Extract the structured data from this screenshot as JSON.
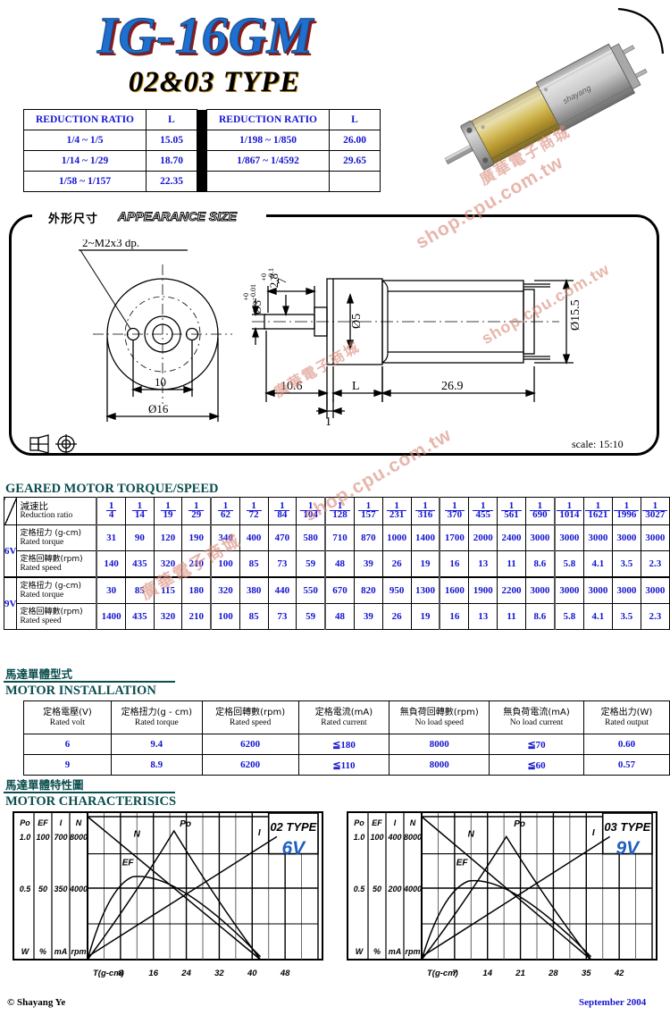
{
  "header": {
    "product_title": "IG-16GM",
    "product_subtitle": "02&03 TYPE"
  },
  "reduction_table": {
    "headers": [
      "REDUCTION RATIO",
      "L"
    ],
    "left_rows": [
      {
        "ratio": "1/4 ~ 1/5",
        "l": "15.05"
      },
      {
        "ratio": "1/14 ~ 1/29",
        "l": "18.70"
      },
      {
        "ratio": "1/58 ~ 1/157",
        "l": "22.35"
      }
    ],
    "right_rows": [
      {
        "ratio": "1/198 ~ 1/850",
        "l": "26.00"
      },
      {
        "ratio": "1/867 ~ 1/4592",
        "l": "29.65"
      },
      {
        "ratio": "",
        "l": ""
      }
    ]
  },
  "appearance": {
    "title_cn": "外形尺寸",
    "title_en": "APPEARANCE SIZE",
    "scale_label": "scale:  15:10",
    "dims": {
      "thread_note": "2~M2x3  dp.",
      "bolt_circle": "10",
      "flange_dia": "ø16",
      "shaft_dia": "ø3",
      "shaft_tol_top": "+0",
      "shaft_tol_bot": "−0.01",
      "flat_dim": "2.8",
      "flat_tol_top": "+0",
      "flat_tol_bot": "−0.1",
      "shaft_len": "7",
      "front_len": "10.6",
      "gearbox_len": "L",
      "step": "1",
      "motor_len": "26.9",
      "body_dia": "ø15.5",
      "motor_shaft_dia": "ø5"
    }
  },
  "torque_speed": {
    "title": "GEARED MOTOR TORQUE/SPEED",
    "row_label_cn": "減速比",
    "row_label_en": "Reduction ratio",
    "torque_cn": "定格扭力 (g-cm)",
    "torque_en": "Rated torque",
    "speed_cn": "定格回轉數(rpm)",
    "speed_en": "Rated speed",
    "ratios": [
      "4",
      "14",
      "19",
      "29",
      "62",
      "72",
      "84",
      "104",
      "128",
      "157",
      "231",
      "316",
      "370",
      "455",
      "561",
      "690",
      "1014",
      "1621",
      "1996",
      "3027"
    ],
    "v6": {
      "label": "6V",
      "torque": [
        "31",
        "90",
        "120",
        "190",
        "340",
        "400",
        "470",
        "580",
        "710",
        "870",
        "1000",
        "1400",
        "1700",
        "2000",
        "2400",
        "3000",
        "3000",
        "3000",
        "3000",
        "3000"
      ],
      "speed": [
        "140",
        "435",
        "320",
        "210",
        "100",
        "85",
        "73",
        "59",
        "48",
        "39",
        "26",
        "19",
        "16",
        "13",
        "11",
        "8.6",
        "5.8",
        "4.1",
        "3.5",
        "2.3"
      ]
    },
    "v9": {
      "label": "9V",
      "torque": [
        "30",
        "85",
        "115",
        "180",
        "320",
        "380",
        "440",
        "550",
        "670",
        "820",
        "950",
        "1300",
        "1600",
        "1900",
        "2200",
        "3000",
        "3000",
        "3000",
        "3000",
        "3000"
      ],
      "speed": [
        "1400",
        "435",
        "320",
        "210",
        "100",
        "85",
        "73",
        "59",
        "48",
        "39",
        "26",
        "19",
        "16",
        "13",
        "11",
        "8.6",
        "5.8",
        "4.1",
        "3.5",
        "2.3"
      ]
    }
  },
  "installation": {
    "title_cn": "馬達單體型式",
    "title_en": "MOTOR INSTALLATION",
    "headers": [
      {
        "cn": "定格電壓(V)",
        "en": "Rated volt"
      },
      {
        "cn": "定格扭力(g - cm)",
        "en": "Rated torque"
      },
      {
        "cn": "定格回轉數(rpm)",
        "en": "Rated speed"
      },
      {
        "cn": "定格電流(mA)",
        "en": "Rated current"
      },
      {
        "cn": "無負荷回轉數(rpm)",
        "en": "No load speed"
      },
      {
        "cn": "無負荷電流(mA)",
        "en": "No load current"
      },
      {
        "cn": "定格出力(W)",
        "en": "Rated output"
      }
    ],
    "rows": [
      [
        "6",
        "9.4",
        "6200",
        "≦180",
        "8000",
        "≦70",
        "0.60"
      ],
      [
        "9",
        "8.9",
        "6200",
        "≦110",
        "8000",
        "≦60",
        "0.57"
      ]
    ]
  },
  "characteristics": {
    "title_cn": "馬達單體特性圖",
    "title_en": "MOTOR CHARACTERISICS"
  },
  "chart_data": [
    {
      "type": "line",
      "title": "02 TYPE",
      "voltage": "6V",
      "xlabel": "T(g-cm)",
      "x_ticks": [
        "8",
        "16",
        "24",
        "32",
        "40",
        "48"
      ],
      "xlim": [
        0,
        56
      ],
      "grid": true,
      "legend_position": "inline-labels",
      "axes": [
        {
          "name": "Po",
          "unit": "W",
          "ticks": [
            "1.0",
            "0.5"
          ],
          "zero": "W"
        },
        {
          "name": "EF",
          "unit": "%",
          "ticks": [
            "100",
            "50"
          ],
          "zero": "%"
        },
        {
          "name": "I",
          "unit": "mA",
          "ticks": [
            "700",
            "350"
          ],
          "zero": "mA"
        },
        {
          "name": "N",
          "unit": "rpm",
          "ticks": [
            "8000",
            "4000"
          ],
          "zero": "rpm"
        }
      ],
      "series": [
        {
          "name": "N",
          "label": "N",
          "kind": "speed",
          "x": [
            0,
            42
          ],
          "y_frac": [
            1.0,
            0.0
          ]
        },
        {
          "name": "I",
          "label": "I",
          "kind": "current",
          "x": [
            0,
            46
          ],
          "y_frac": [
            0.02,
            0.86
          ]
        },
        {
          "name": "Po",
          "label": "Po",
          "kind": "power",
          "x": [
            0,
            21,
            42
          ],
          "y_frac": [
            0.0,
            0.9,
            0.0
          ]
        },
        {
          "name": "EF",
          "label": "EF",
          "kind": "efficiency",
          "x": [
            0,
            11,
            42
          ],
          "y_frac": [
            0.0,
            0.58,
            0.02
          ]
        }
      ]
    },
    {
      "type": "line",
      "title": "03 TYPE",
      "voltage": "9V",
      "xlabel": "T(g-cm)",
      "x_ticks": [
        "7",
        "14",
        "21",
        "28",
        "35",
        "42"
      ],
      "xlim": [
        0,
        49
      ],
      "grid": true,
      "legend_position": "inline-labels",
      "axes": [
        {
          "name": "Po",
          "unit": "W",
          "ticks": [
            "1.0",
            "0.5"
          ],
          "zero": "W"
        },
        {
          "name": "EF",
          "unit": "%",
          "ticks": [
            "100",
            "50"
          ],
          "zero": "%"
        },
        {
          "name": "I",
          "unit": "mA",
          "ticks": [
            "400",
            "200"
          ],
          "zero": "mA"
        },
        {
          "name": "N",
          "unit": "rpm",
          "ticks": [
            "8000",
            "4000"
          ],
          "zero": "rpm"
        }
      ],
      "series": [
        {
          "name": "N",
          "label": "N",
          "kind": "speed",
          "x": [
            0,
            36
          ],
          "y_frac": [
            1.0,
            0.0
          ]
        },
        {
          "name": "I",
          "label": "I",
          "kind": "current",
          "x": [
            0,
            40
          ],
          "y_frac": [
            0.02,
            0.86
          ]
        },
        {
          "name": "Po",
          "label": "Po",
          "kind": "power",
          "x": [
            0,
            18,
            36
          ],
          "y_frac": [
            0.0,
            0.86,
            0.0
          ]
        },
        {
          "name": "EF",
          "label": "EF",
          "kind": "efficiency",
          "x": [
            0,
            10,
            36
          ],
          "y_frac": [
            0.0,
            0.55,
            0.02
          ]
        }
      ]
    }
  ],
  "footer": {
    "copyright": "© Shayang Ye",
    "date": "September 2004"
  },
  "watermark": {
    "line1": "shop.cpu.com.tw",
    "line2": "廣華電子商城"
  }
}
